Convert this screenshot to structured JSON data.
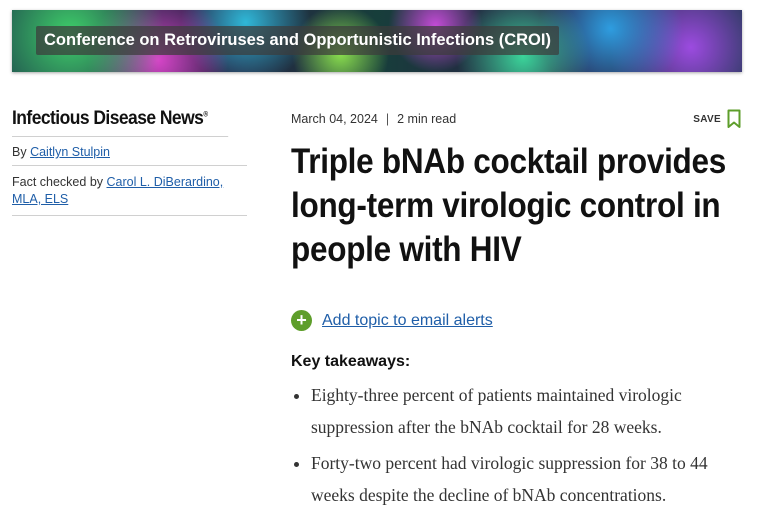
{
  "banner": {
    "title": "Conference on Retroviruses and Opportunistic Infections (CROI)"
  },
  "sidebar": {
    "brand": "Infectious Disease News",
    "by_label": "By",
    "author": "Caitlyn Stulpin",
    "fact_label": "Fact checked by",
    "fact_checker": "Carol L. DiBerardino, MLA, ELS"
  },
  "article": {
    "date": "March 04, 2024",
    "separator": "|",
    "read_time": "2 min read",
    "save_label": "SAVE",
    "title": "Triple bNAb cocktail provides long-term virologic control in people with HIV",
    "alert_link": "Add topic to email alerts",
    "takeaways_heading": "Key takeaways:",
    "takeaways": [
      "Eighty-three percent of patients maintained virologic suppression after the bNAb cocktail for 28 weeks.",
      "Forty-two percent had virologic suppression for 38 to 44 weeks despite the decline of bNAb concentrations."
    ]
  },
  "colors": {
    "link": "#1f5ea8",
    "alert_icon": "#5e9e2b",
    "save_icon": "#5e9e2b"
  },
  "icons": {
    "save": "bookmark-icon",
    "alert": "plus-circle-icon"
  }
}
